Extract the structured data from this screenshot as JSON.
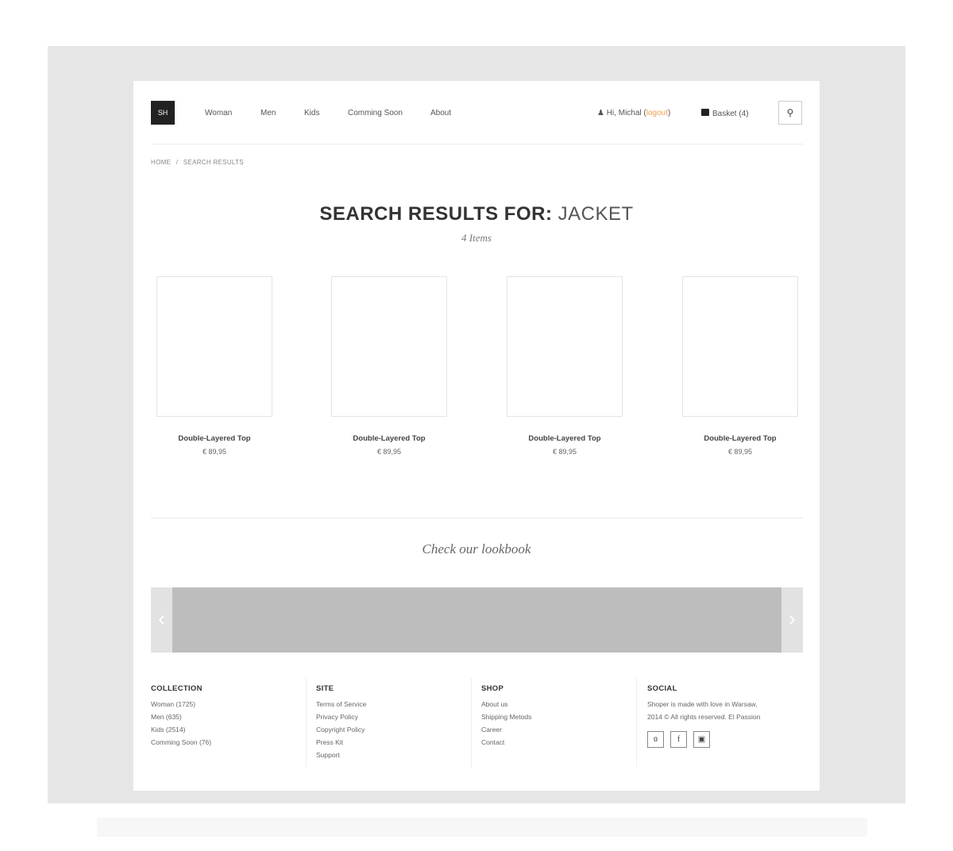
{
  "header": {
    "logo": "SH",
    "nav": [
      "Woman",
      "Men",
      "Kids",
      "Comming Soon",
      "About"
    ],
    "greeting": "Hi, Michal (",
    "logout": "logout",
    "greeting_end": ")",
    "basket": "Basket (4)"
  },
  "breadcrumb": {
    "home": "HOME",
    "sep": "/",
    "current": "SEARCH RESULTS"
  },
  "search": {
    "label": "SEARCH RESULTS FOR:",
    "query": "JACKET",
    "count": "4 Items"
  },
  "products": [
    {
      "name": "Double-Layered Top",
      "price": "€ 89,95"
    },
    {
      "name": "Double-Layered Top",
      "price": "€ 89,95"
    },
    {
      "name": "Double-Layered Top",
      "price": "€ 89,95"
    },
    {
      "name": "Double-Layered Top",
      "price": "€ 89,95"
    }
  ],
  "lookbook": {
    "title": "Check our lookbook",
    "prev": "‹",
    "next": "›"
  },
  "footer": {
    "collection": {
      "title": "COLLECTION",
      "items": [
        "Woman (1725)",
        "Men (635)",
        "Kids (2514)",
        "Comming Soon (76)"
      ]
    },
    "site": {
      "title": "SITE",
      "items": [
        "Terms of Service",
        "Privacy Policy",
        "Copyright Policy",
        "Press Kit",
        "Support"
      ]
    },
    "shop": {
      "title": "SHOP",
      "items": [
        "About us",
        "Shipping Metods",
        "Career",
        "Contact"
      ]
    },
    "social": {
      "title": "SOCIAL",
      "line1": "Shoper is made with love in Warsaw,",
      "line2": "2014 © All rights reserved. El Passion",
      "icons": [
        "twitter-icon",
        "facebook-icon",
        "instagram-icon"
      ]
    }
  },
  "colors": {
    "accent": "#f0a050",
    "logo_bg": "#222222",
    "carousel": "#bdbdbd"
  }
}
